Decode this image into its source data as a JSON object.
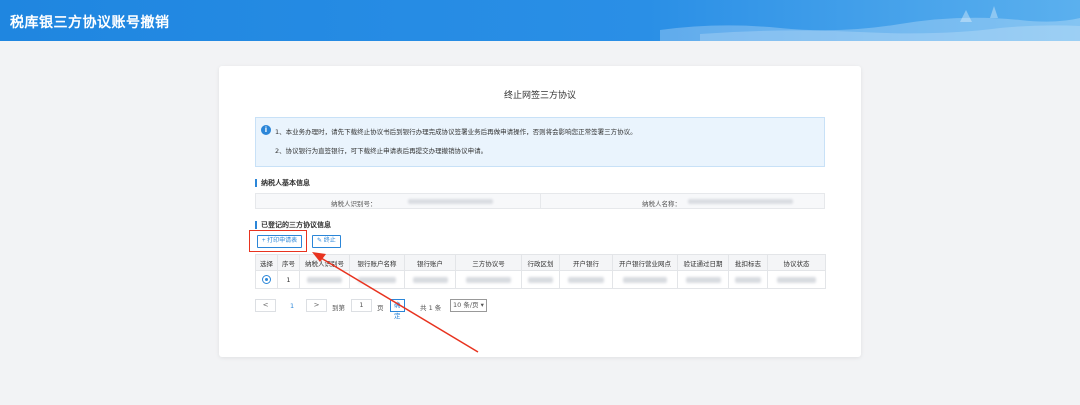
{
  "header": {
    "title": "税库银三方协议账号撤销"
  },
  "card": {
    "title": "终止网签三方协议"
  },
  "notice": {
    "icon": "info-icon",
    "line1": "1、本业务办理时，请先下载终止协议书后到银行办理完成协议签署业务后再做申请操作，否则将会影响您正常签署三方协议。",
    "line2": "2、协议银行为直签银行，可下载终止申请表后再提交办理撤销协议申请。"
  },
  "taxpayer": {
    "section_title": "纳税人基本信息",
    "id_label": "纳税人识别号：",
    "name_label": "纳税人名称："
  },
  "agreements": {
    "section_title": "已登记的三方协议信息",
    "buttons": {
      "print": "+ 打印申请表",
      "terminate": "✎ 终止"
    },
    "columns": [
      "选择",
      "序号",
      "纳税人识别号",
      "银行账户名称",
      "银行账户",
      "三方协议号",
      "行政区划",
      "开户银行",
      "开户银行营业网点",
      "验证通过日期",
      "批扣标志",
      "协议状态"
    ],
    "rows": [
      {
        "index": "1"
      }
    ]
  },
  "pager": {
    "prev": "<",
    "current_page": "1",
    "next": ">",
    "goto_label": "到第",
    "goto_value": "1",
    "page_label": "页",
    "confirm": "确定",
    "total": "共 1 条",
    "page_size": "10 条/页"
  },
  "colors": {
    "accent": "#2b86d8",
    "highlight": "#e8331f",
    "header": "#1f86e0"
  }
}
